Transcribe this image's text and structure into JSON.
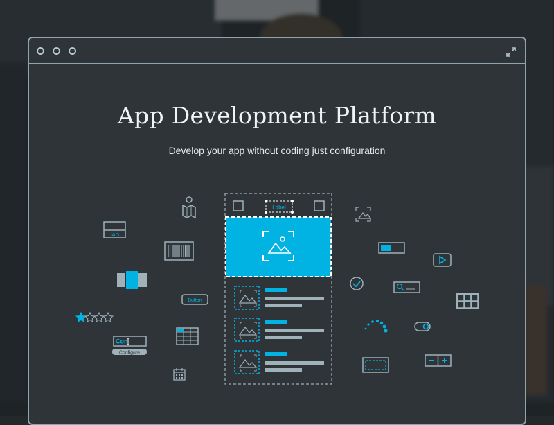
{
  "page": {
    "title": "App Development Platform",
    "subtitle": "Develop your app without coding just configuration"
  },
  "mockup": {
    "label_text": "Label",
    "button_text": "Button",
    "iad_text": "iAD",
    "config_input_text": "Con",
    "config_caption": "Configure",
    "rating_filled": 1,
    "rating_total": 4
  },
  "colors": {
    "accent": "#00b3e3",
    "outline": "#9fb1b9",
    "window_bg": "#2e3438",
    "text": "#f1f3f4"
  },
  "icons": [
    "map-pin-icon",
    "iad-banner-icon",
    "barcode-icon",
    "carousel-icon",
    "button-widget-icon",
    "star-rating-icon",
    "table-icon",
    "config-text-field-icon",
    "calendar-icon",
    "image-capture-icon",
    "progress-bar-icon",
    "video-play-icon",
    "checkmark-icon",
    "search-field-icon",
    "photo-grid-icon",
    "spinner-icon",
    "toggle-switch-icon",
    "image-placeholder-icon",
    "stepper-icon"
  ]
}
